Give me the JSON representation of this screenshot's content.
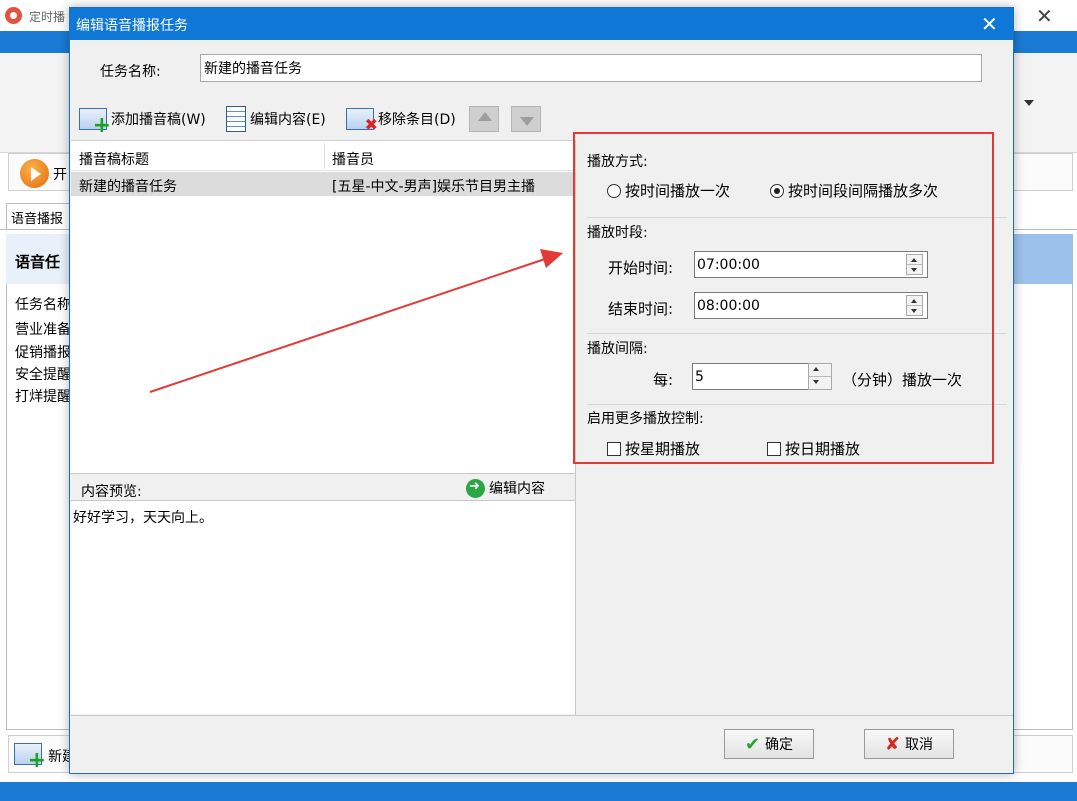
{
  "background_window": {
    "title": "定时播",
    "start_button_label": "开",
    "tab_label": "语音播报",
    "panel_title": "语音任",
    "column_header": "任务名称",
    "rows": [
      "营业准备",
      "促销播报",
      "安全提醒",
      "打烊提醒"
    ],
    "new_button_label": "新建"
  },
  "dialog": {
    "title": "编辑语音播报任务",
    "task_name_label": "任务名称:",
    "task_name_value": "新建的播音任务",
    "toolbar": {
      "add_label": "添加播音稿(W)",
      "edit_label": "编辑内容(E)",
      "remove_label": "移除条目(D)"
    },
    "list": {
      "headers": [
        "播音稿标题",
        "播音员"
      ],
      "rows": [
        {
          "title": "新建的播音任务",
          "speaker": "[五星-中文-男声]娱乐节目男主播"
        }
      ]
    },
    "preview": {
      "label": "内容预览:",
      "edit_label": "编辑内容",
      "text": "好好学习，天天向上。"
    },
    "settings": {
      "mode_title": "播放方式:",
      "mode_options": [
        "按时间播放一次",
        "按时间段间隔播放多次"
      ],
      "mode_selected_index": 1,
      "period_title": "播放时段:",
      "start_label": "开始时间:",
      "start_value": "07:00:00",
      "end_label": "结束时间:",
      "end_value": "08:00:00",
      "interval_title": "播放间隔:",
      "every_label": "每:",
      "interval_value": "5",
      "interval_suffix": "（分钟）播放一次",
      "more_title": "启用更多播放控制:",
      "weekday_label": "按星期播放",
      "weekday_checked": false,
      "date_label": "按日期播放",
      "date_checked": false
    },
    "ok_label": "确定",
    "cancel_label": "取消"
  },
  "annotation": {
    "highlight_color": "#e53935",
    "arrow_color": "#e53935"
  }
}
